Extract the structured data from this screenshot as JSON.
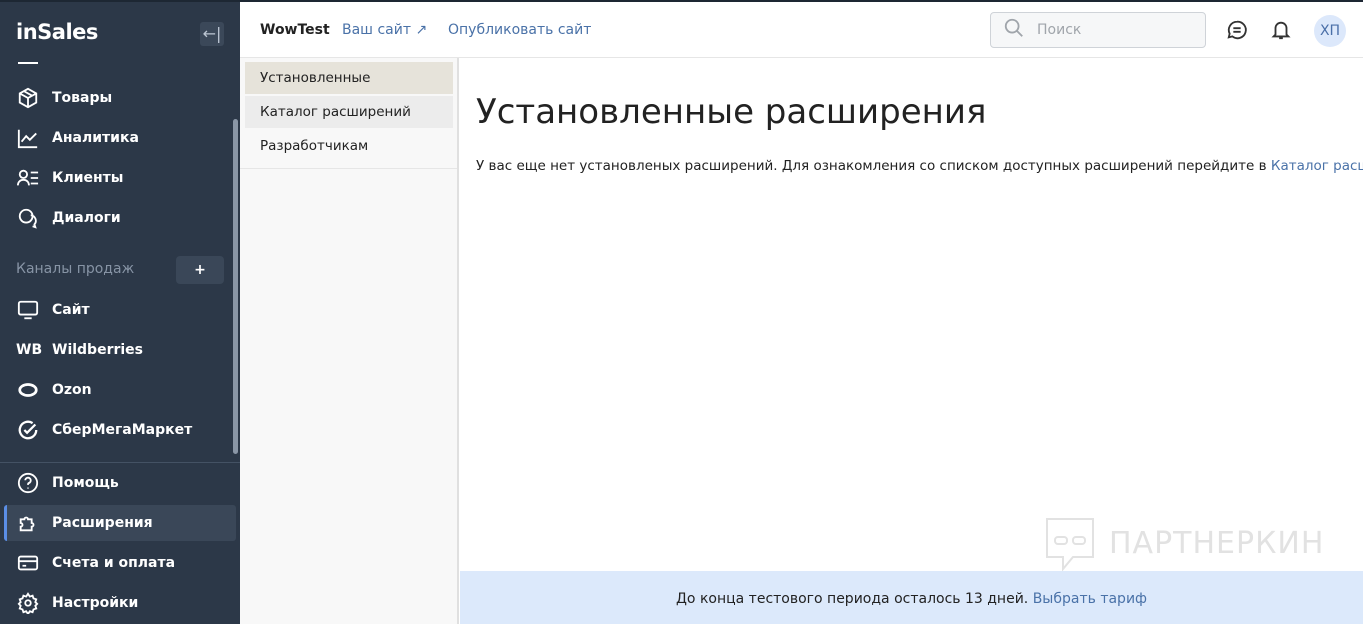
{
  "sidebar": {
    "logo": "inSales",
    "collapse_icon": "←|",
    "items": [
      {
        "label": "Товары"
      },
      {
        "label": "Аналитика"
      },
      {
        "label": "Клиенты"
      },
      {
        "label": "Диалоги"
      }
    ],
    "section": "Каналы продаж",
    "add": "+",
    "channels": [
      {
        "label": "Сайт"
      },
      {
        "label": "Wildberries",
        "badge": "WB"
      },
      {
        "label": "Ozon"
      },
      {
        "label": "СберМегаМаркет"
      }
    ],
    "bottom": [
      {
        "label": "Помощь"
      },
      {
        "label": "Расширения",
        "active": true
      },
      {
        "label": "Счета и оплата"
      },
      {
        "label": "Настройки"
      }
    ]
  },
  "header": {
    "store": "WowTest",
    "your_site": "Ваш сайт",
    "publish": "Опубликовать сайт",
    "search_placeholder": "Поиск",
    "avatar": "ХП"
  },
  "subnav": [
    {
      "label": "Установленные",
      "active": true
    },
    {
      "label": "Каталог расширений"
    },
    {
      "label": "Разработчикам"
    }
  ],
  "main": {
    "title": "Установленные расширения",
    "text": "У вас еще нет установленых расширений. Для ознакомления со списком доступных расширений перейдите в ",
    "link": "Каталог расширений",
    "text_end": "."
  },
  "banner": {
    "text": "До конца тестового периода осталось 13 дней. ",
    "link": "Выбрать тариф"
  },
  "watermark": "ПАРТНЕРКИН",
  "colors": {
    "sidebar": "#2c3848",
    "accent": "#4a72a8",
    "banner": "#dce9fb"
  }
}
